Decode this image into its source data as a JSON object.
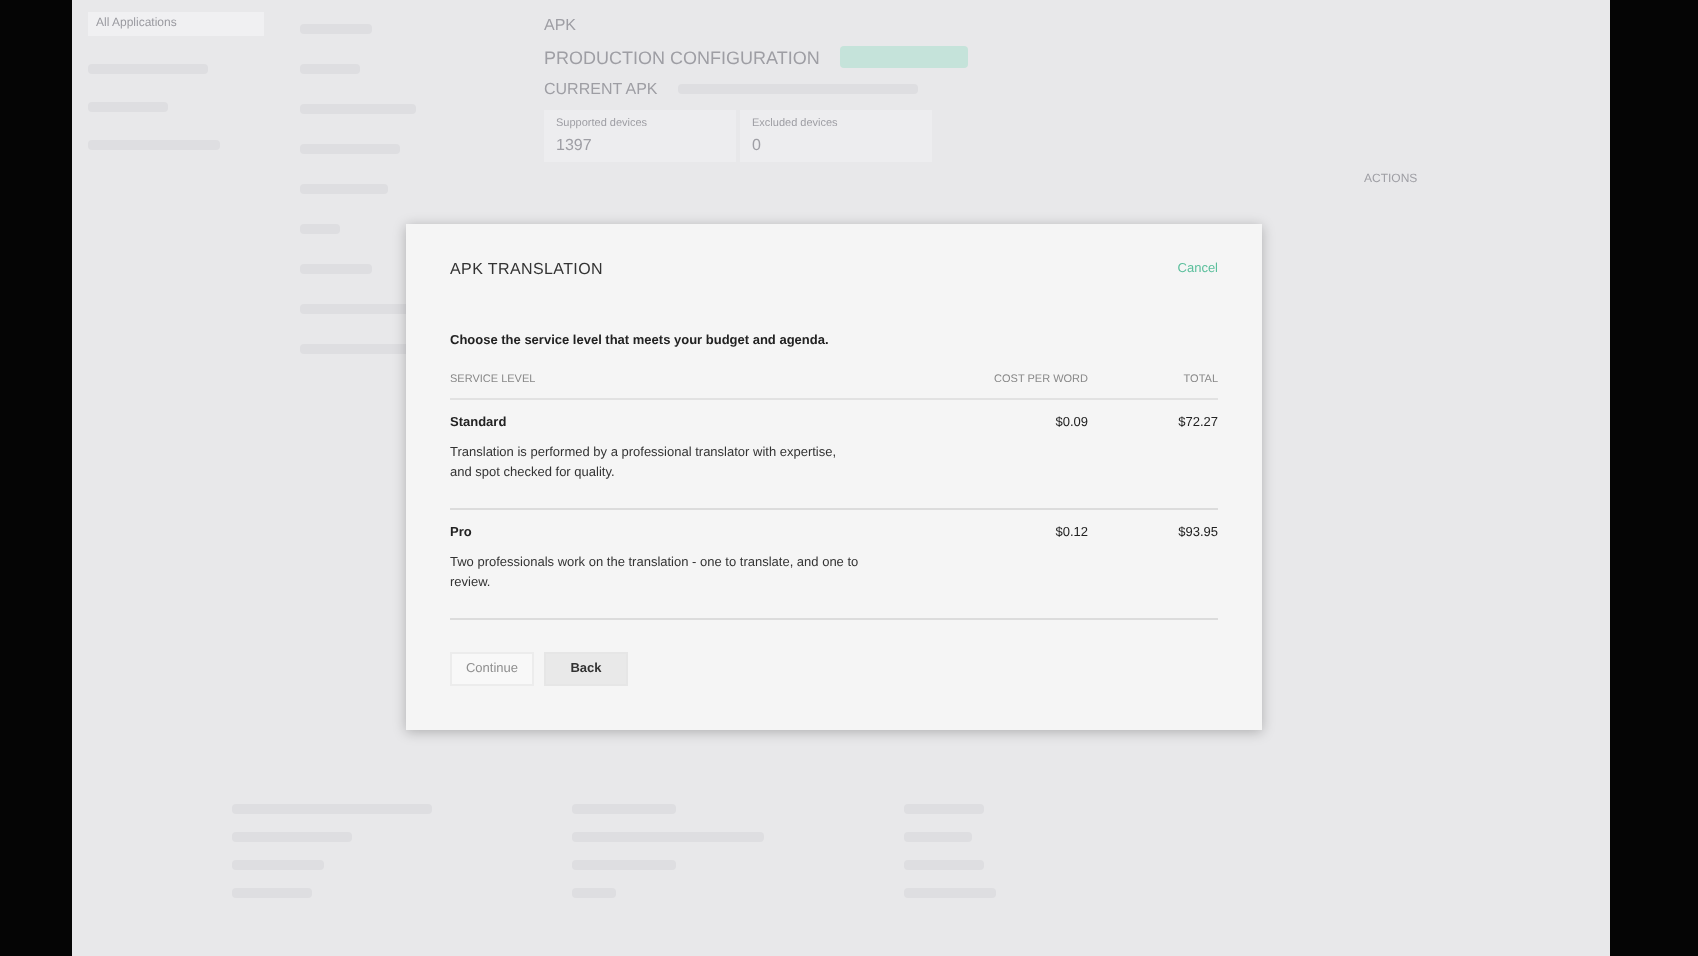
{
  "nav": {
    "items": [
      {
        "label": "All Applications",
        "selected": true
      }
    ]
  },
  "main": {
    "title": "APK",
    "section": "PRODUCTION CONFIGURATION",
    "current_apk": "CURRENT APK",
    "stats": [
      {
        "label": "Supported devices",
        "value": "1397"
      },
      {
        "label": "Excluded devices",
        "value": "0"
      }
    ],
    "actions_label": "ACTIONS"
  },
  "dialog": {
    "title": "APK TRANSLATION",
    "cancel": "Cancel",
    "intro": "Choose the service level that meets your budget and agenda.",
    "columns": [
      "SERVICE LEVEL",
      "COST PER WORD",
      "TOTAL"
    ],
    "rows": [
      {
        "name": "Standard",
        "description": "Translation is performed by a professional translator with expertise, and spot checked for quality.",
        "cost": "$0.09",
        "total": "$72.27"
      },
      {
        "name": "Pro",
        "description": "Two professionals work on the translation - one to translate, and one to review.",
        "cost": "$0.12",
        "total": "$93.95"
      }
    ],
    "buttons": [
      {
        "label": "Continue",
        "disabled": true
      },
      {
        "label": "Back",
        "disabled": false
      }
    ]
  }
}
